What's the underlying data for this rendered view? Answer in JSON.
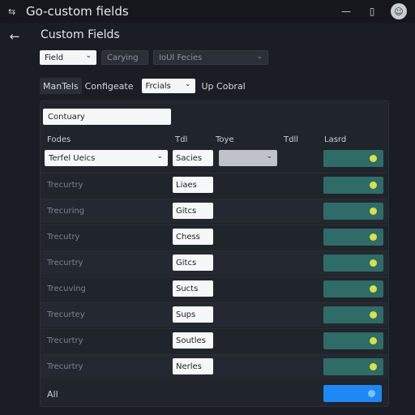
{
  "window": {
    "title": "Go-custom fields"
  },
  "page": {
    "title": "Custom Fields"
  },
  "filters": {
    "field_select": "Field",
    "option_1": "Carying",
    "option_2": "IoUl Fecies"
  },
  "tabs": {
    "tab_1": "ManTels",
    "tab_2": "Configeate",
    "tab_select": "Frcials",
    "tab_4": "Up Cobral"
  },
  "table": {
    "search_value": "Contuary",
    "headers": [
      "Fodes",
      "Tdl",
      "Toye",
      "Tdll",
      "Lasrd"
    ],
    "first_row": {
      "name_select": "Terfel Ueics",
      "field": "Sacies"
    },
    "rows": [
      {
        "name": "Trecurtry",
        "field": "Liaes"
      },
      {
        "name": "Trecuring",
        "field": "Gitcs"
      },
      {
        "name": "Trecutry",
        "field": "Chess"
      },
      {
        "name": "Trecurtry",
        "field": "Gitcs"
      },
      {
        "name": "Trecuving",
        "field": "Sucts"
      },
      {
        "name": "Trecurtey",
        "field": "Sups"
      },
      {
        "name": "Trecurtry",
        "field": "Soutles"
      },
      {
        "name": "Trecurtry",
        "field": "Nerles"
      }
    ],
    "footer_label": "All"
  },
  "colors": {
    "background": "#1a1d23",
    "toggle": "#2f6b67",
    "primary": "#1e88f5"
  }
}
